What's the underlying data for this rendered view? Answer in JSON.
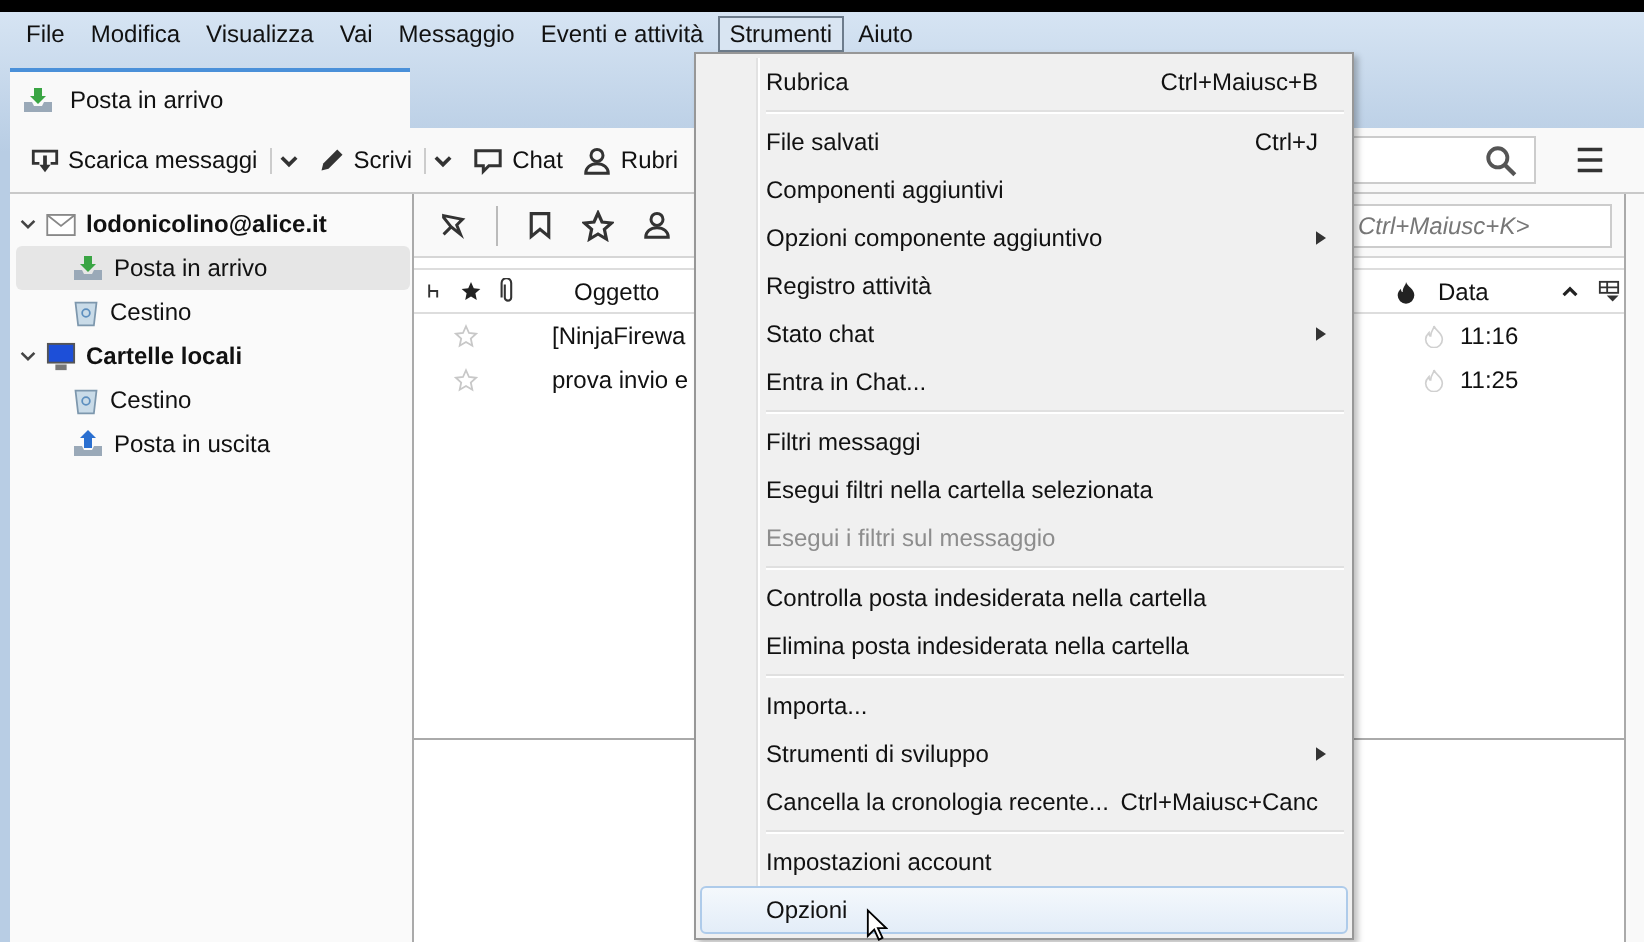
{
  "menubar": [
    {
      "label": "File",
      "selected": false
    },
    {
      "label": "Modifica",
      "selected": false
    },
    {
      "label": "Visualizza",
      "selected": false
    },
    {
      "label": "Vai",
      "selected": false
    },
    {
      "label": "Messaggio",
      "selected": false
    },
    {
      "label": "Eventi e attività",
      "selected": false
    },
    {
      "label": "Strumenti",
      "selected": true
    },
    {
      "label": "Aiuto",
      "selected": false
    }
  ],
  "tab": {
    "label": "Posta in arrivo"
  },
  "toolbar": {
    "buttons": [
      {
        "label": "Scarica messaggi",
        "kind": "download",
        "dropdown": true
      },
      {
        "label": "Scrivi",
        "kind": "write",
        "dropdown": true
      },
      {
        "label": "Chat",
        "kind": "chat",
        "dropdown": false
      },
      {
        "label": "Rubri",
        "kind": "contacts",
        "dropdown": false
      }
    ]
  },
  "folders": [
    {
      "label": "lodonicolino@alice.it",
      "kind": "mail",
      "expanded": true,
      "children": [
        {
          "label": "Posta in arrivo",
          "kind": "inbox",
          "selected": true
        },
        {
          "label": "Cestino",
          "kind": "trash",
          "selected": false
        }
      ]
    },
    {
      "label": "Cartelle locali",
      "kind": "local",
      "expanded": true,
      "children": [
        {
          "label": "Cestino",
          "kind": "trash",
          "selected": false
        },
        {
          "label": "Posta in uscita",
          "kind": "outbox",
          "selected": false
        }
      ]
    }
  ],
  "quick_filter": {
    "placeholder": "Ctrl+Maiusc+K>"
  },
  "message_list": {
    "columns": [
      {
        "label": "Oggetto"
      },
      {
        "label": "Data"
      }
    ],
    "rows": [
      {
        "subject": "[NinjaFirewa",
        "date": "11:16",
        "starred": false
      },
      {
        "subject": "prova invio e",
        "date": "11:25",
        "starred": false
      }
    ]
  },
  "menu": {
    "groups": [
      [
        {
          "label": "Rubrica",
          "shortcut": "Ctrl+Maiusc+B",
          "submenu": false,
          "disabled": false,
          "selected": false
        }
      ],
      [
        {
          "label": "File salvati",
          "shortcut": "Ctrl+J",
          "submenu": false,
          "disabled": false,
          "selected": false
        },
        {
          "label": "Componenti aggiuntivi",
          "submenu": false,
          "disabled": false,
          "selected": false
        },
        {
          "label": "Opzioni componente aggiuntivo",
          "submenu": true,
          "disabled": false,
          "selected": false
        },
        {
          "label": "Registro attività",
          "submenu": false,
          "disabled": false,
          "selected": false
        },
        {
          "label": "Stato chat",
          "submenu": true,
          "disabled": false,
          "selected": false
        },
        {
          "label": "Entra in Chat...",
          "submenu": false,
          "disabled": false,
          "selected": false
        }
      ],
      [
        {
          "label": "Filtri messaggi",
          "submenu": false,
          "disabled": false,
          "selected": false
        },
        {
          "label": "Esegui filtri nella cartella selezionata",
          "submenu": false,
          "disabled": false,
          "selected": false
        },
        {
          "label": "Esegui i filtri sul messaggio",
          "submenu": false,
          "disabled": true,
          "selected": false
        }
      ],
      [
        {
          "label": "Controlla posta indesiderata nella cartella",
          "submenu": false,
          "disabled": false,
          "selected": false
        },
        {
          "label": "Elimina posta indesiderata nella cartella",
          "submenu": false,
          "disabled": false,
          "selected": false
        }
      ],
      [
        {
          "label": "Importa...",
          "submenu": false,
          "disabled": false,
          "selected": false
        },
        {
          "label": "Strumenti di sviluppo",
          "submenu": true,
          "disabled": false,
          "selected": false
        },
        {
          "label": "Cancella la cronologia recente...",
          "shortcut": "Ctrl+Maiusc+Canc",
          "submenu": false,
          "disabled": false,
          "selected": false
        }
      ],
      [
        {
          "label": "Impostazioni account",
          "submenu": false,
          "disabled": false,
          "selected": false
        },
        {
          "label": "Opzioni",
          "submenu": false,
          "disabled": false,
          "selected": true
        }
      ]
    ]
  }
}
